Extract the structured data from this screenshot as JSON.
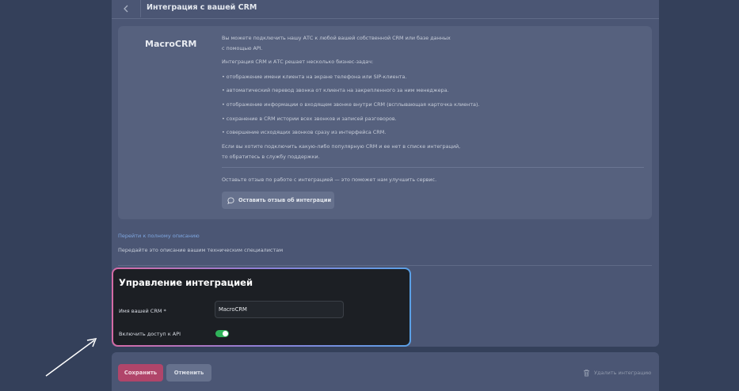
{
  "header": {
    "back_icon": "chevron-left-icon",
    "title": "Интеграция с вашей CRM"
  },
  "info_card": {
    "crm_name": "MacroCRM",
    "description_lines": [
      "Вы можете подключить нашу АТС к любой вашей собственной CRM или базе данных",
      "с помощью API.",
      "Интеграция CRM и АТС решает несколько бизнес-задач:",
      "• отображение имени клиента на экране телефона или SIP-клиента.",
      "• автоматический перевод звонка от клиента на закрепленного за ним менеджера.",
      "• отображение информации о входящем звонке внутри CRM (всплывающая карточка клиента).",
      "• сохранение в CRM истории всех звонков и записей разговоров.",
      "• совершение исходящих звонков сразу из интерфейса CRM.",
      "Если вы хотите подключить какую-либо популярную CRM и ее нет в списке интеграций,",
      "то обратитесь в службу поддержки."
    ],
    "feedback_text": "Оставьте отзыв по работе с интеграцией — это поможет нам улучшить сервис.",
    "feedback_button": "Оставить отзыв об интеграции",
    "feedback_icon": "chat-bubble-icon"
  },
  "links": {
    "full_description": "Перейти к полному описанию",
    "tech_text": "Передайте это описание вашим техническим специалистам"
  },
  "management": {
    "title": "Управление интеграцией",
    "crm_name_label": "Имя вашей CRM *",
    "crm_name_value": "MacroCRM",
    "api_label": "Включить доступ к API",
    "api_enabled": true
  },
  "footer": {
    "save": "Сохранить",
    "cancel": "Отменить",
    "delete": "Удалить интеграцию",
    "delete_icon": "trash-icon"
  },
  "colors": {
    "background": "#34405a",
    "panel": "#4b5674",
    "save_button": "#b0456a",
    "toggle_on": "#2fb35a",
    "link": "#7ea6e0"
  }
}
